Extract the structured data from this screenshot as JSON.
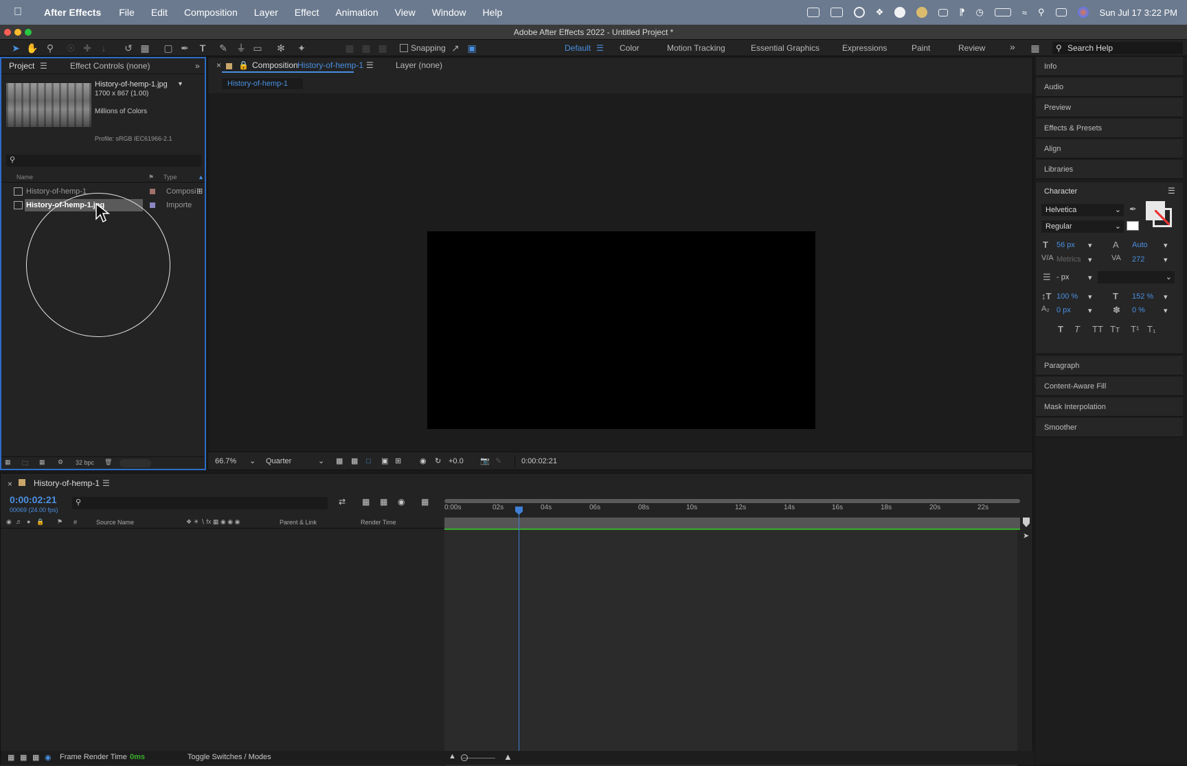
{
  "menubar": {
    "app_name": "After Effects",
    "items": [
      "File",
      "Edit",
      "Composition",
      "Layer",
      "Effect",
      "Animation",
      "View",
      "Window",
      "Help"
    ],
    "datetime": "Sun Jul 17  3:22 PM"
  },
  "window_title": "Adobe After Effects 2022 - Untitled Project *",
  "toolbar": {
    "snapping_label": "Snapping",
    "workspaces": [
      "Default",
      "Color",
      "Motion Tracking",
      "Essential Graphics",
      "Expressions",
      "Paint",
      "Review"
    ],
    "active_workspace": "Default",
    "search_placeholder": "Search Help"
  },
  "project": {
    "tab_label": "Project",
    "effect_controls_label": "Effect Controls (none)",
    "file_name": "History-of-hemp-1.jpg",
    "dimensions": "1700 x 867 (1.00)",
    "colors": "Millions of Colors",
    "profile": "Profile: sRGB IEC61966-2.1",
    "col_name": "Name",
    "col_type": "Type",
    "rows": [
      {
        "name": "History-of-hemp-1",
        "type": "Composi",
        "swatch": "#a0706a"
      },
      {
        "name": "History-of-hemp-1.jpg",
        "type": "Importe",
        "swatch": "#8a86c0"
      }
    ],
    "bpc": "32 bpc"
  },
  "composition": {
    "tab_prefix": "Composition",
    "tab_name": "History-of-hemp-1",
    "layer_tab": "Layer (none)",
    "subtab": "History-of-hemp-1",
    "zoom": "66.7%",
    "resolution": "Quarter",
    "exposure": "+0.0",
    "timecode": "0:00:02:21"
  },
  "right_panel": {
    "items_top": [
      "Info",
      "Audio",
      "Preview",
      "Effects & Presets",
      "Align",
      "Libraries"
    ],
    "character_title": "Character",
    "font_family": "Helvetica",
    "font_style": "Regular",
    "font_size": "56 px",
    "leading": "Auto",
    "kerning": "Metrics",
    "tracking": "272",
    "stroke_width": "- px",
    "vert_scale": "100 %",
    "horiz_scale": "152 %",
    "baseline_shift": "0 px",
    "tsume": "0 %",
    "items_bottom": [
      "Paragraph",
      "Content-Aware Fill",
      "Mask Interpolation",
      "Smoother"
    ]
  },
  "timeline": {
    "tab_name": "History-of-hemp-1",
    "current_time": "0:00:02:21",
    "frame_info": "00069 (24.00 fps)",
    "col_source_name": "Source Name",
    "col_parent": "Parent & Link",
    "col_render_time": "Render Time",
    "col_hash": "#",
    "ruler_labels": [
      "0:00s",
      "02s",
      "04s",
      "06s",
      "08s",
      "10s",
      "12s",
      "14s",
      "16s",
      "18s",
      "20s",
      "22s"
    ],
    "frame_render_label": "Frame Render Time",
    "frame_render_value": "0ms",
    "toggle_label": "Toggle Switches / Modes"
  },
  "colors": {
    "accent": "#4a90e2",
    "panel_bg": "#232323",
    "green_bar": "#38b02a"
  }
}
